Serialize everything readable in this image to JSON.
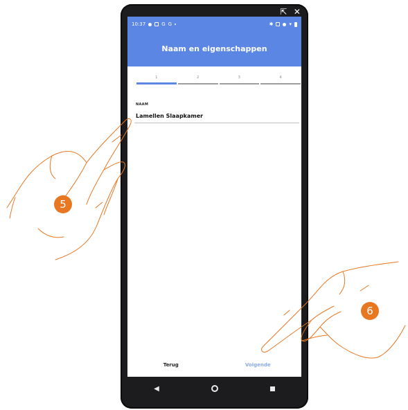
{
  "window": {
    "controls": "⇱ ✕"
  },
  "statusbar": {
    "time": "10:37"
  },
  "appbar": {
    "title": "Naam en eigenschappen"
  },
  "steps": [
    {
      "label": "1",
      "active": true
    },
    {
      "label": "2",
      "active": false
    },
    {
      "label": "3",
      "active": false
    },
    {
      "label": "4",
      "active": false
    }
  ],
  "form": {
    "name_label": "NAAM",
    "name_value": "Lamellen Slaapkamer"
  },
  "footer": {
    "back_label": "Terug",
    "next_label": "Volgende"
  },
  "navbar": {
    "back_icon": "◀"
  },
  "markers": {
    "first": "5",
    "second": "6"
  },
  "colors": {
    "accent": "#5b86e3",
    "marker": "#e87722",
    "phone": "#1c1c1e"
  }
}
